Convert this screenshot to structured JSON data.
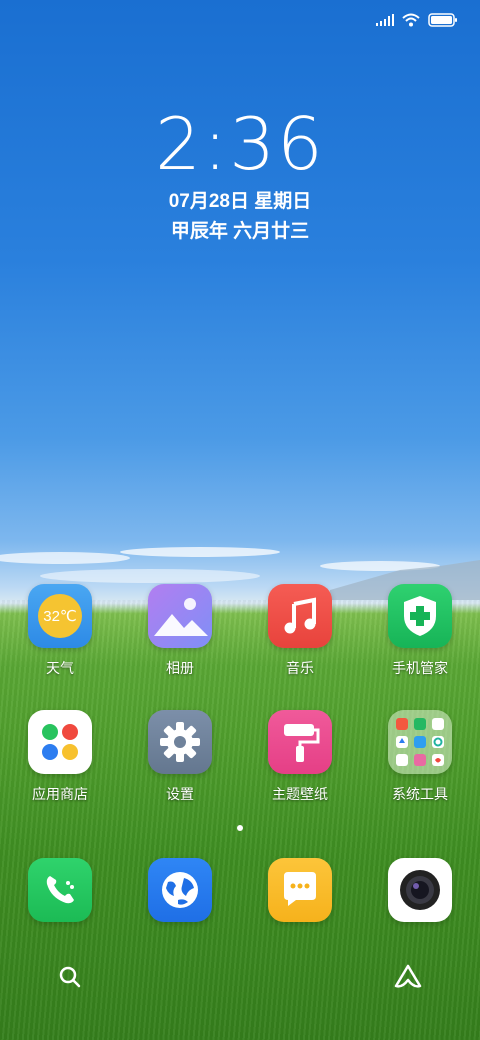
{
  "status_bar": {
    "icons": [
      "signal-icon",
      "wifi-icon",
      "battery-icon"
    ]
  },
  "lockscreen": {
    "time": "2:36",
    "date": "07月28日 星期日",
    "lunar": "甲辰年 六月廿三"
  },
  "apps_row1": [
    {
      "label": "天气",
      "icon": "weather-icon",
      "temp": "32℃"
    },
    {
      "label": "相册",
      "icon": "gallery-icon"
    },
    {
      "label": "音乐",
      "icon": "music-icon"
    },
    {
      "label": "手机管家",
      "icon": "security-shield-icon"
    }
  ],
  "apps_row2": [
    {
      "label": "应用商店",
      "icon": "app-store-icon"
    },
    {
      "label": "设置",
      "icon": "settings-gear-icon"
    },
    {
      "label": "主题壁纸",
      "icon": "paint-roller-icon"
    },
    {
      "label": "系统工具",
      "icon": "folder-icon"
    }
  ],
  "dock": [
    {
      "icon": "phone-icon"
    },
    {
      "icon": "browser-globe-icon"
    },
    {
      "icon": "messages-icon"
    },
    {
      "icon": "camera-icon"
    }
  ],
  "page_indicator": {
    "count": 1,
    "active": 0
  },
  "bottom": {
    "left_icon": "search-icon",
    "right_icon": "assistant-icon"
  }
}
